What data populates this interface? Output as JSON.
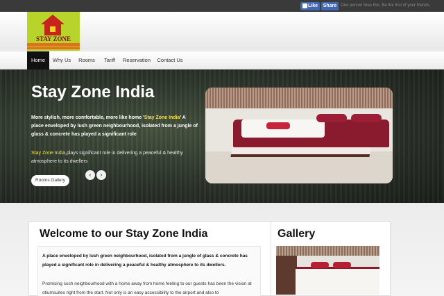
{
  "social": {
    "like_label": "Like",
    "share_label": "Share",
    "like_text": "One person likes this. Be the first of your friends."
  },
  "logo": {
    "title": "STAY ZONE",
    "brand_color": "#b8d32a"
  },
  "nav": {
    "items": [
      "Home",
      "Why Us",
      "Rooms",
      "Tariff",
      "Reservation",
      "Contact Us"
    ],
    "active_index": 0
  },
  "hero": {
    "title": "Stay Zone India",
    "para1_pre": "More stylish, more comfortable, more like home '",
    "para1_highlight": "Stay Zone India",
    "para1_post": "' A place enveloped by lush green neighbourhood, isolated from a jungle of glass & concrete has played a significant role",
    "para2_highlight": "Stay Zone India",
    "para2_post": ",plays significant role in delivering a peaceful & healthy atmosphere to its dwellers",
    "prev_icon": "‹",
    "next_icon": "›",
    "gallery_button": "Rooms Gallery",
    "highlight_color": "#f5e04a"
  },
  "welcome": {
    "title": "Welcome to our Stay Zone India",
    "bold_text": "A place enveloped by lush green neighbourhood, isolated from a jungle of glass & concrete has played a significant role in delivering a peaceful & healthy atmosphere to its dwellers.",
    "body_text": "Promising such neighbourhood with a home away from home feeling to our guests has been the vision at otiumsuites right from the start. Not only is an easy accessibility to the airport and also to"
  },
  "gallery": {
    "title": "Gallery"
  }
}
